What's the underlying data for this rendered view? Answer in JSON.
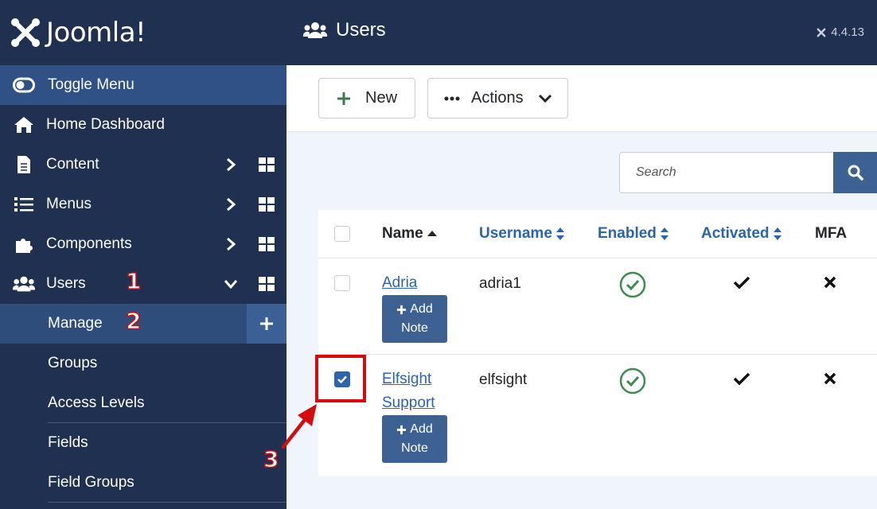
{
  "brand": {
    "name": "Joomla!"
  },
  "sidebar": {
    "toggle_label": "Toggle Menu",
    "items": [
      {
        "label": "Home Dashboard",
        "icon": "home-icon"
      },
      {
        "label": "Content",
        "icon": "file-icon"
      },
      {
        "label": "Menus",
        "icon": "list-icon"
      },
      {
        "label": "Components",
        "icon": "puzzle-icon"
      },
      {
        "label": "Users",
        "icon": "users-icon"
      }
    ],
    "subitems": [
      {
        "label": "Manage"
      },
      {
        "label": "Groups"
      },
      {
        "label": "Access Levels"
      },
      {
        "label": "Fields"
      },
      {
        "label": "Field Groups"
      }
    ]
  },
  "annotations": [
    "1",
    "2",
    "3"
  ],
  "header": {
    "title": "Users",
    "version": "4.4.13"
  },
  "toolbar": {
    "new_label": "New",
    "actions_label": "Actions"
  },
  "search": {
    "placeholder": "Search"
  },
  "table": {
    "columns": {
      "name": "Name",
      "username": "Username",
      "enabled": "Enabled",
      "activated": "Activated",
      "mfa": "MFA"
    },
    "rows": [
      {
        "name": "Adria",
        "username": "adria1",
        "note_add": "Add",
        "note_label": "Note",
        "checked": false
      },
      {
        "name_line1": "Elfsight",
        "name_line2": "Support",
        "username": "elfsight",
        "note_add": "Add",
        "note_label": "Note",
        "checked": true
      }
    ]
  },
  "colors": {
    "sidebar_bg": "#1f3050",
    "accent": "#2a64ae",
    "enabled_green": "#3d8b4e",
    "annotation_red": "#d40c0c"
  }
}
